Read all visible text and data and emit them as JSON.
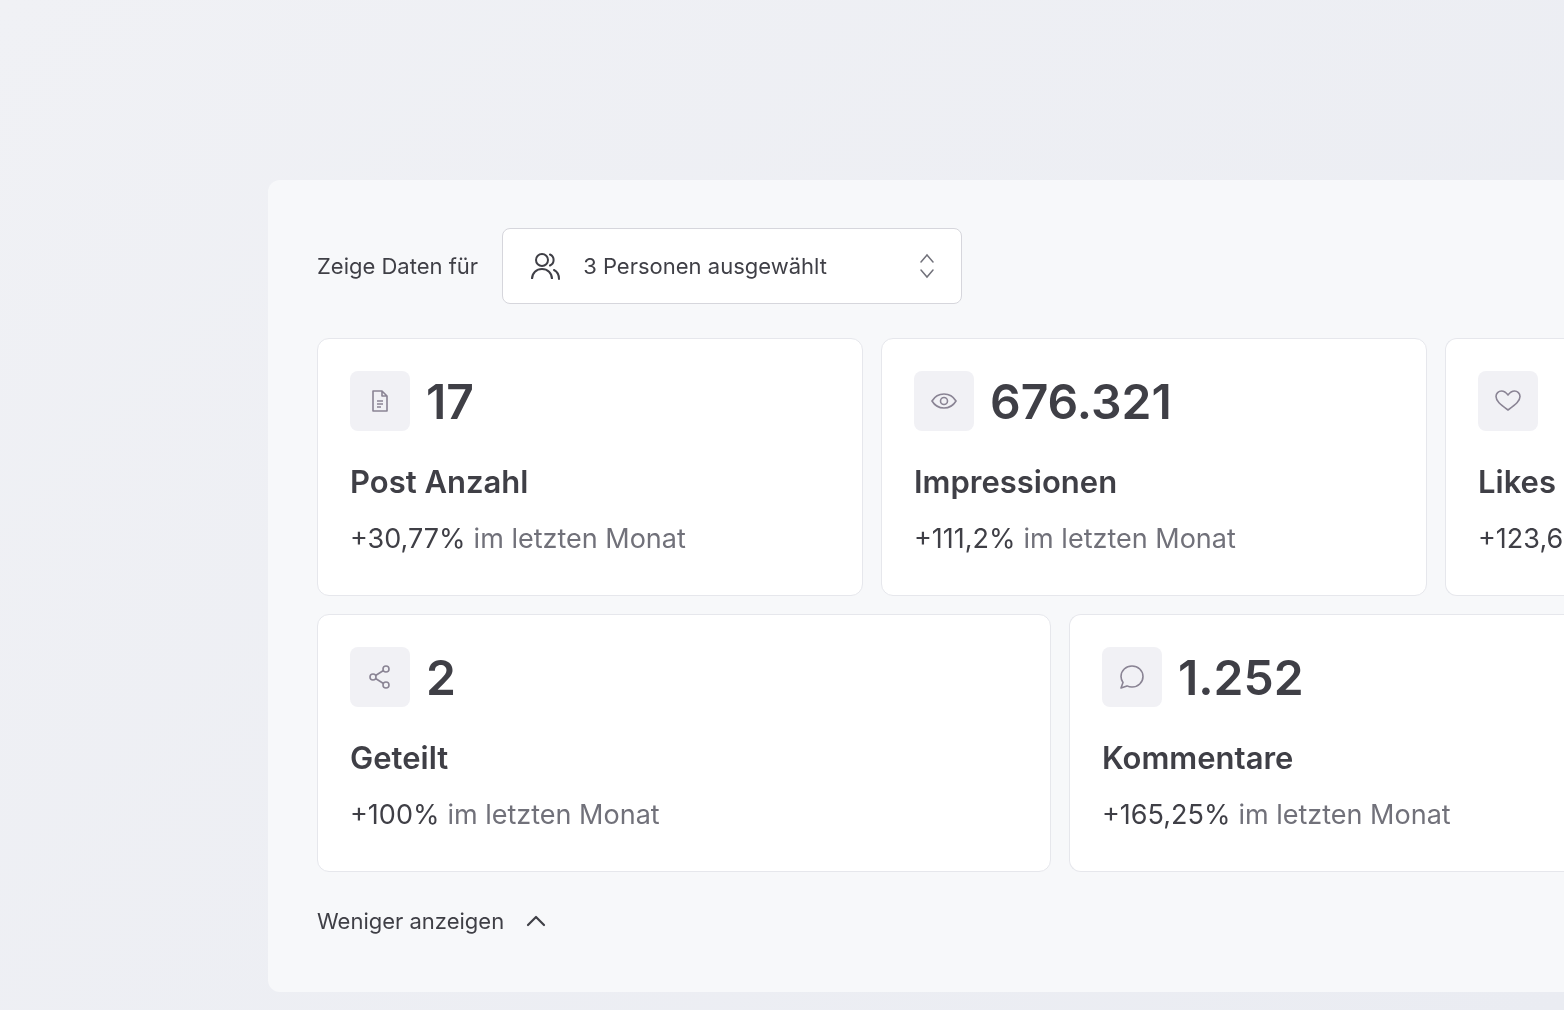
{
  "filter": {
    "label": "Zeige Daten für",
    "value": "3 Personen ausgewählt"
  },
  "stat_rows": [
    [
      {
        "kind": "posts",
        "value": "17",
        "label": "Post Anzahl",
        "change": "+30,77%",
        "note": "im letzten Monat"
      },
      {
        "kind": "impressions",
        "value": "676.321",
        "label": "Impressionen",
        "change": "+111,2%",
        "note": "im letzten Monat"
      },
      {
        "kind": "likes",
        "label": "Likes",
        "change": "+123,6"
      }
    ],
    [
      {
        "kind": "shares",
        "value": "2",
        "label": "Geteilt",
        "change": "+100%",
        "note": "im letzten Monat"
      },
      {
        "kind": "comments",
        "value": "1.252",
        "label": "Kommentare",
        "change": "+165,25%",
        "note": "im letzten Monat"
      }
    ]
  ],
  "toggle": {
    "label": "Weniger anzeigen",
    "expanded": true
  }
}
